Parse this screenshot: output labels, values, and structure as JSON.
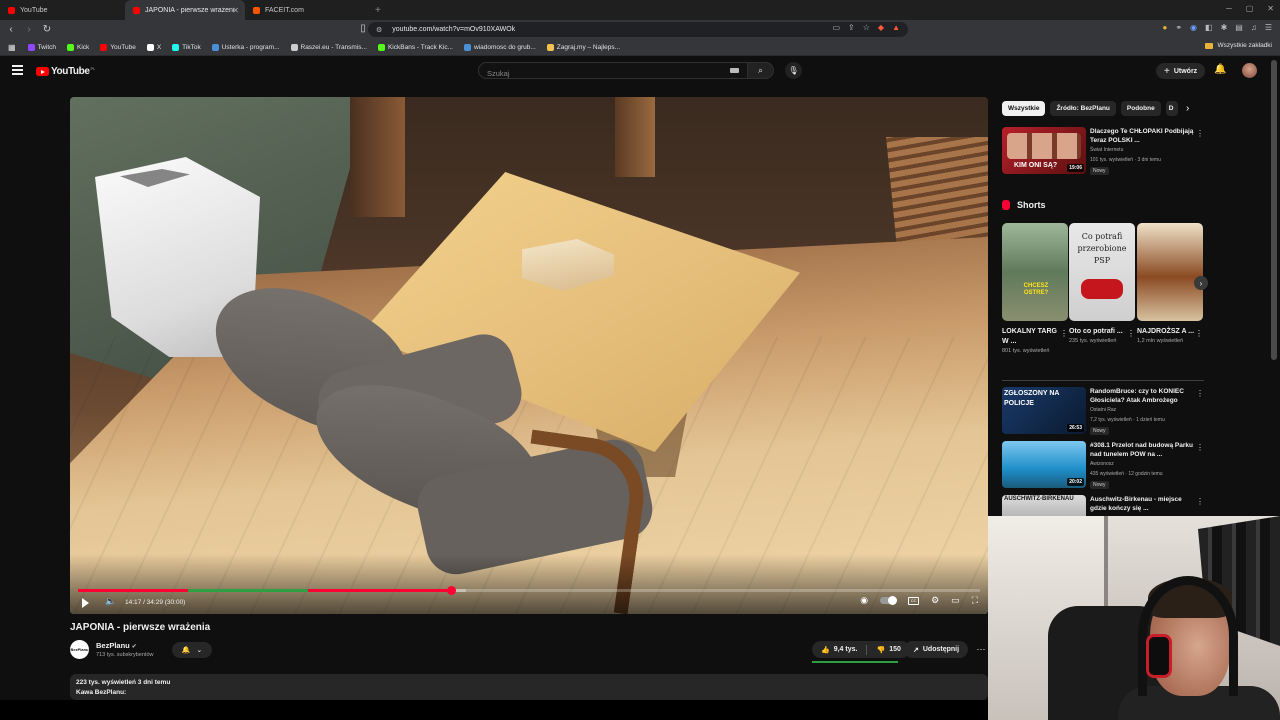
{
  "browser": {
    "tabs": [
      {
        "label": "YouTube",
        "color": "#ff0000",
        "active": false
      },
      {
        "label": "JAPONIA - pierwsze wrażenia - Y",
        "color": "#ff0000",
        "active": true
      },
      {
        "label": "FACEIT.com",
        "color": "#ff5500",
        "active": false
      }
    ],
    "new_tab": "+",
    "url": "youtube.com/watch?v=mOv910XAWOk",
    "bookmarks": [
      {
        "label": "Twitch",
        "color": "#9146ff"
      },
      {
        "label": "Kick",
        "color": "#53fc18"
      },
      {
        "label": "YouTube",
        "color": "#ff0000"
      },
      {
        "label": "X",
        "color": "#ffffff"
      },
      {
        "label": "TikTok",
        "color": "#25f4ee"
      },
      {
        "label": "Usterka - program...",
        "color": "#4a90d9"
      },
      {
        "label": "Raszei.eu - Transmis...",
        "color": "#cccccc"
      },
      {
        "label": "KickBans - Track Kic...",
        "color": "#53fc18"
      },
      {
        "label": "wiadomosc do grub...",
        "color": "#4a90d9"
      },
      {
        "label": "Zagraj.my – Najleps...",
        "color": "#f2c14e"
      }
    ],
    "all_bookmarks": "Wszystkie zakładki"
  },
  "youtube": {
    "logo_text": "YouTube",
    "country_code": "PL",
    "search_placeholder": "Szukaj",
    "create_label": "Utwórz"
  },
  "player": {
    "time": "14:17 / 34:29 (30:00)",
    "progress_fraction": 0.414,
    "buffer_fraction": 0.43
  },
  "video": {
    "title": "JAPONIA - pierwsze wrażenia",
    "channel_avatar_text": "BezPlanu",
    "channel": "BezPlanu",
    "subscribers": "713 tys. subskrybentów",
    "likes": "9,4 tys.",
    "dislikes": "150",
    "share": "Udostępnij",
    "desc_line1": "223 tys. wyświetleń  3 dni temu",
    "desc_line2": "Kawa BezPlanu:"
  },
  "sidebar": {
    "chips": [
      "Wszystkie",
      "Źródło: BezPlanu",
      "Podobne",
      "D"
    ],
    "recs_top": [
      {
        "title": "Dlaczego Te CHŁOPAKI Podbijają Teraz POLSKI ...",
        "channel": "Świat Internetu",
        "meta": "101 tys. wyświetleń · 3 dni temu",
        "badge": "Nowy",
        "duration": "19:06",
        "thumb_text": "KIM ONI SĄ?"
      }
    ],
    "shorts_label": "Shorts",
    "shorts": [
      {
        "title": "LOKALNY TARG W ...",
        "views": "801 tys. wyświetleń",
        "overlay": "CHCESZ OSTRE?"
      },
      {
        "title": "Oto co potrafi ...",
        "views": "235 tys. wyświetleń",
        "overlay": "Co potrafi przerobione PSP"
      },
      {
        "title": "NAJDROŻSZ A ...",
        "views": "1,2 mln wyświetleń",
        "overlay": ""
      }
    ],
    "recs_bottom": [
      {
        "title": "RandomBruce: czy to KONIEC Głosiciela? Atak Ambrożego",
        "channel": "Ostatni Raz",
        "meta": "7,2 tys. wyświetleń · 1 dzień temu",
        "badge": "Nowy",
        "duration": "26:53",
        "thumb_text": "ZGŁOSZONY NA POLICJE"
      },
      {
        "title": "#308.1 Przelot nad budową Parku nad tunelem POW na ...",
        "channel": "Awizonosz",
        "meta": "435 wyświetleń · 12 godzin temu",
        "badge": "Nowy",
        "duration": "20:02",
        "thumb_text": ""
      },
      {
        "title": "Auschwitz-Birkenau - miejsce gdzie kończy się ...",
        "channel": "",
        "meta": "",
        "badge": "",
        "duration": "",
        "thumb_text": "AUSCHWITZ-BIRKENAU"
      }
    ]
  }
}
